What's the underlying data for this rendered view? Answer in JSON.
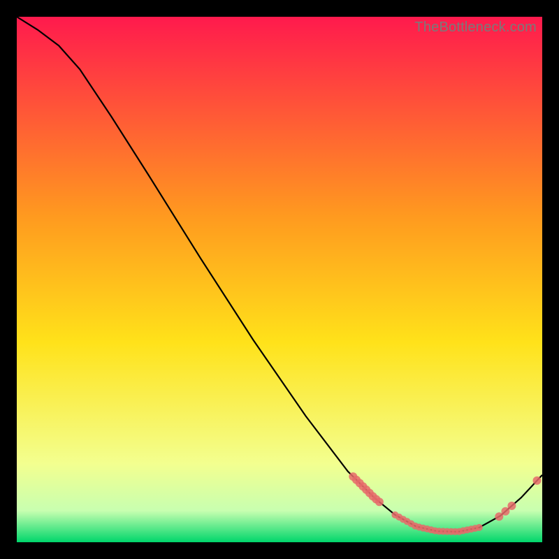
{
  "watermark": "TheBottleneck.com",
  "colors": {
    "dot": "#e66a6a",
    "curve": "#000000",
    "grad_top": "#ff1a4d",
    "grad_mid1": "#ff9a1f",
    "grad_mid2": "#ffe21a",
    "grad_low1": "#f3ff8f",
    "grad_low2": "#c8ffb0",
    "grad_bot": "#00d66b"
  },
  "chart_data": {
    "type": "line",
    "title": "",
    "xlabel": "",
    "ylabel": "",
    "xlim": [
      0,
      100
    ],
    "ylim": [
      0,
      100
    ],
    "curve": [
      {
        "x": 0,
        "y": 100
      },
      {
        "x": 4,
        "y": 97.5
      },
      {
        "x": 8,
        "y": 94.5
      },
      {
        "x": 12,
        "y": 90
      },
      {
        "x": 18,
        "y": 81
      },
      {
        "x": 25,
        "y": 70
      },
      {
        "x": 35,
        "y": 54
      },
      {
        "x": 45,
        "y": 38.5
      },
      {
        "x": 55,
        "y": 24
      },
      {
        "x": 63,
        "y": 13.5
      },
      {
        "x": 68,
        "y": 8.5
      },
      {
        "x": 72,
        "y": 5.2
      },
      {
        "x": 76,
        "y": 3.0
      },
      {
        "x": 80,
        "y": 2.1
      },
      {
        "x": 84,
        "y": 2.0
      },
      {
        "x": 88,
        "y": 2.8
      },
      {
        "x": 92,
        "y": 5.0
      },
      {
        "x": 96,
        "y": 8.5
      },
      {
        "x": 100,
        "y": 12.8
      }
    ],
    "dot_clusters": [
      {
        "center_x": 66.5,
        "spread_x": 2.5,
        "n": 9,
        "size": 6,
        "on_curve": true
      },
      {
        "center_x": 80,
        "spread_x": 8,
        "n": 22,
        "size": 5,
        "on_curve": true
      },
      {
        "center_x": 93,
        "spread_x": 1.2,
        "n": 3,
        "size": 6,
        "on_curve": true
      },
      {
        "center_x": 99,
        "spread_x": 0.5,
        "n": 1,
        "size": 6,
        "on_curve": true
      }
    ]
  }
}
